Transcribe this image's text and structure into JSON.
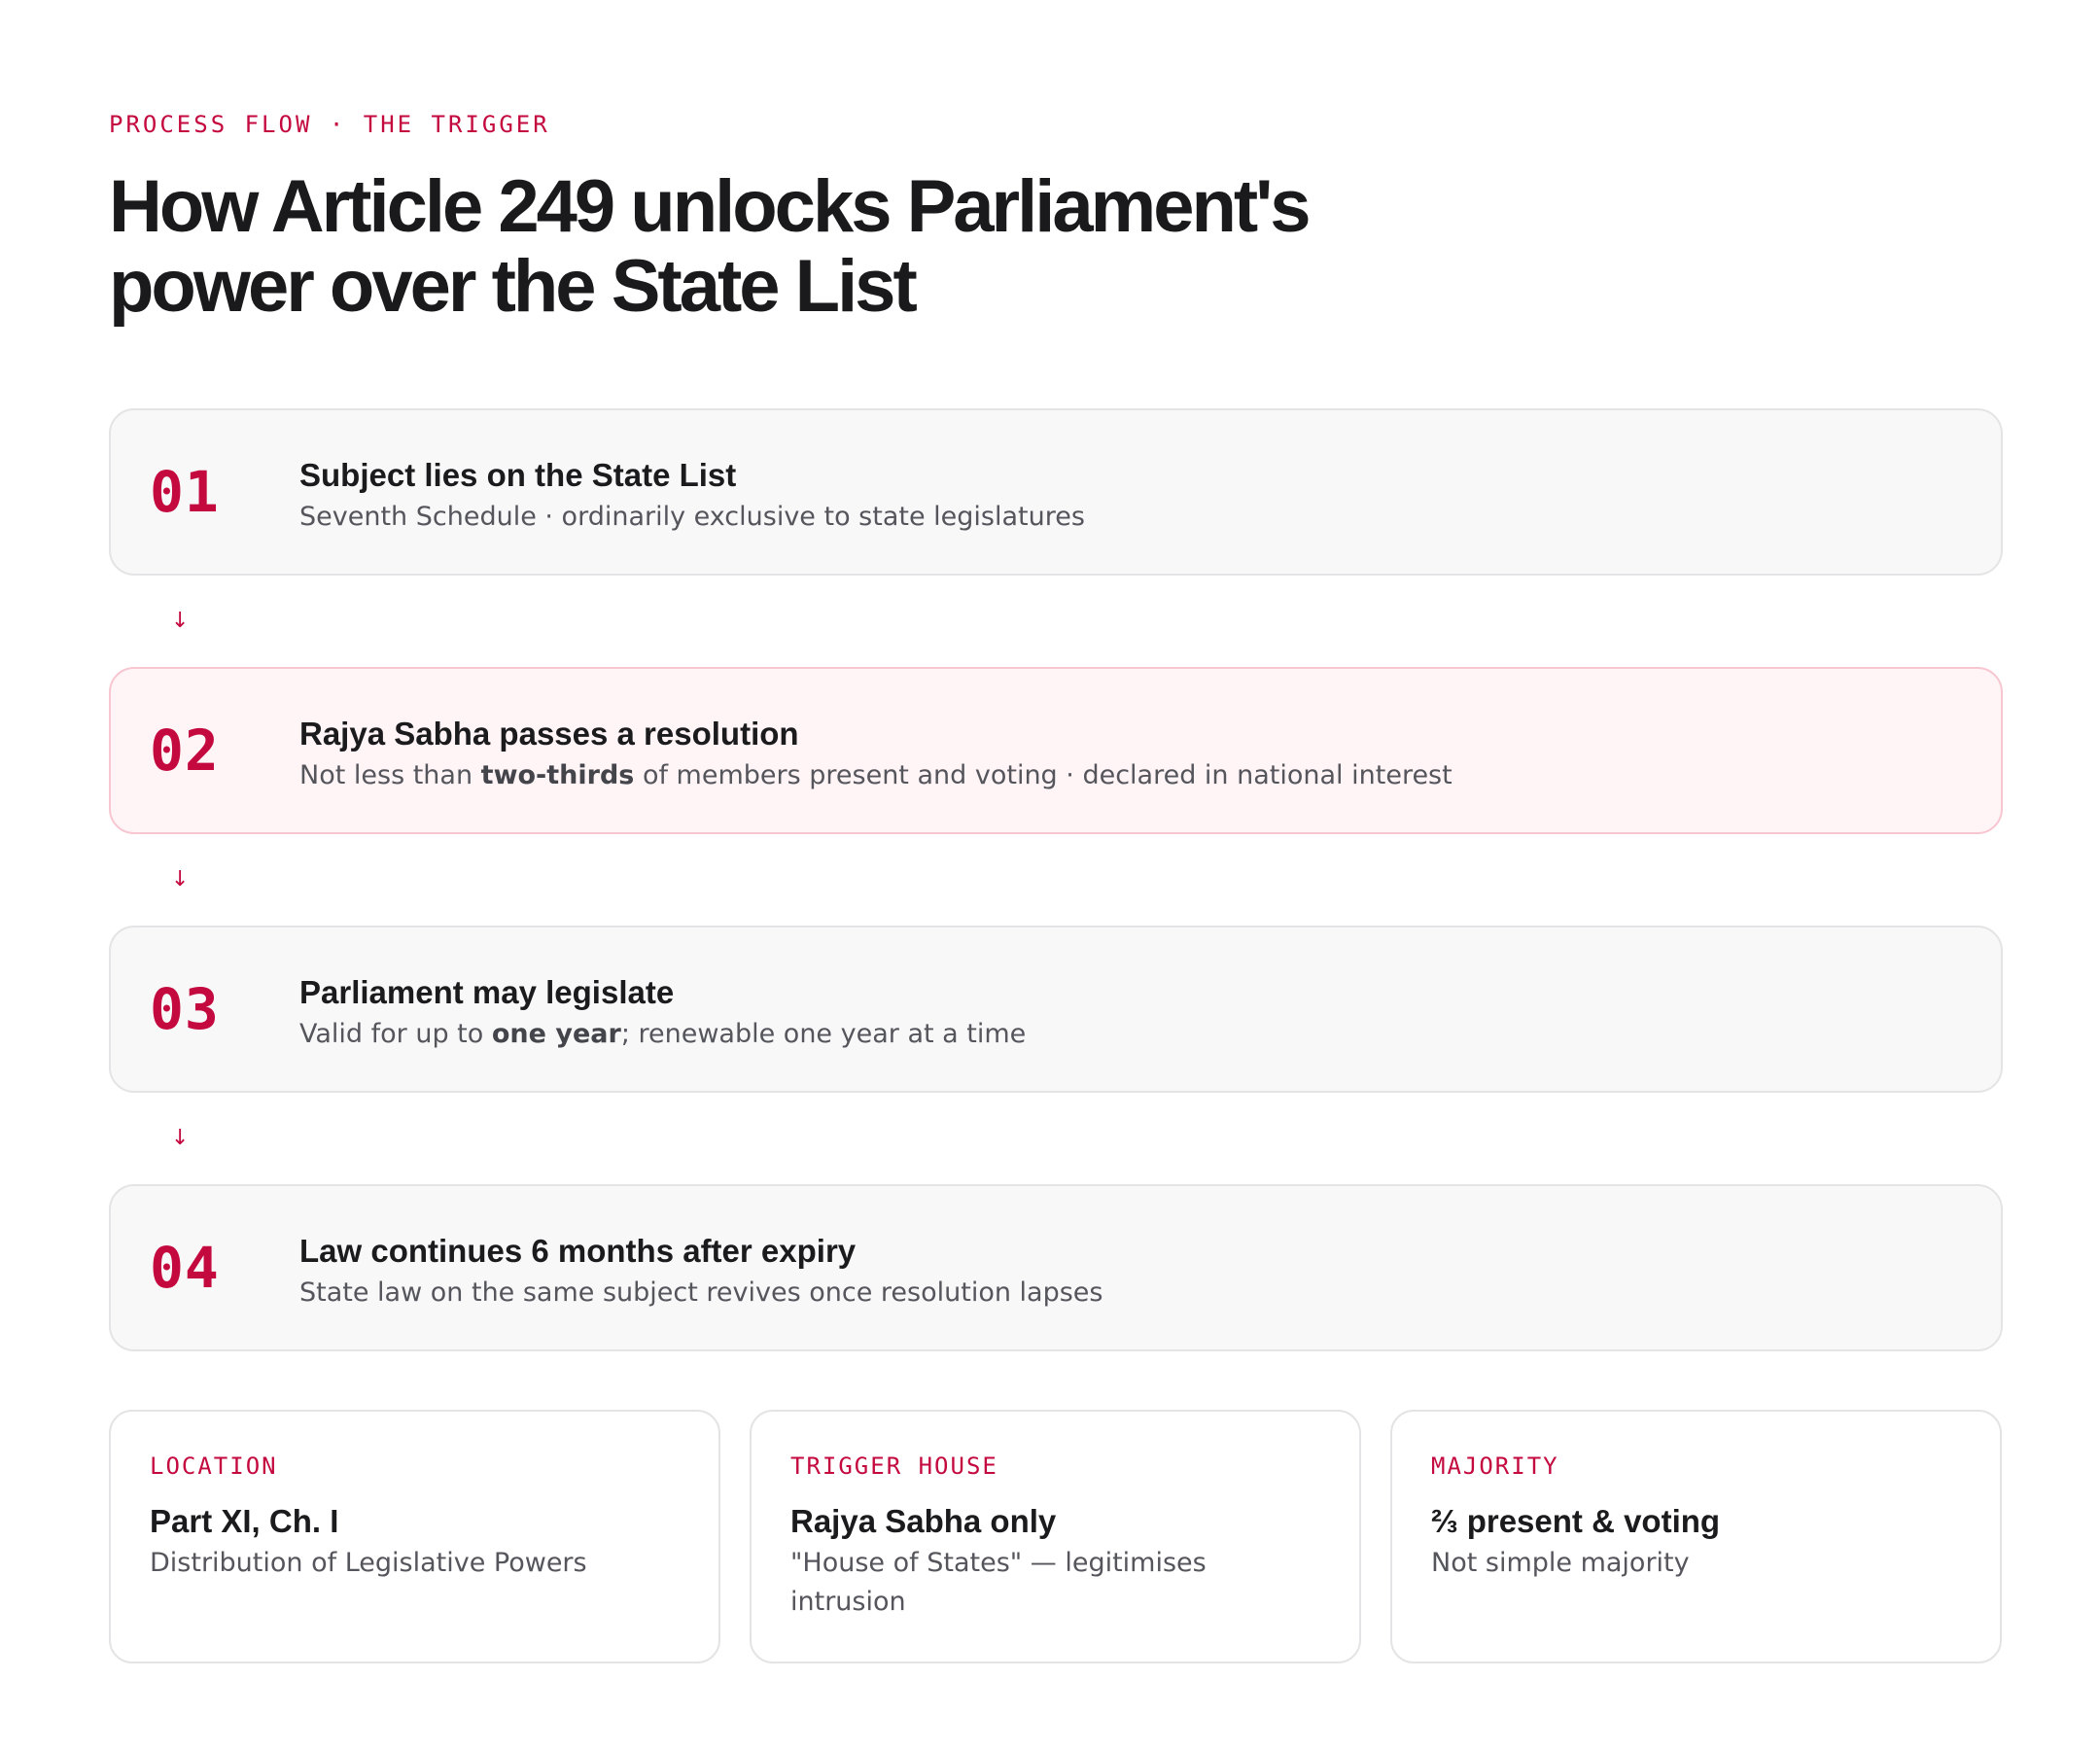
{
  "header": {
    "eyebrow": "PROCESS FLOW · THE TRIGGER",
    "title": "How Article 249 unlocks Parliament's power over the State List"
  },
  "steps": [
    {
      "number": "01",
      "title": "Subject lies on the State List",
      "subtitle_parts": [
        "Seventh Schedule · ordinarily exclusive to state legislatures"
      ],
      "highlight": false
    },
    {
      "number": "02",
      "title": "Rajya Sabha passes a resolution",
      "subtitle_parts": [
        "Not less than ",
        "two-thirds",
        " of members present and voting · declared in national interest"
      ],
      "highlight": true
    },
    {
      "number": "03",
      "title": "Parliament may legislate",
      "subtitle_parts": [
        "Valid for up to ",
        "one year",
        "; renewable one year at a time"
      ],
      "highlight": false
    },
    {
      "number": "04",
      "title": "Law continues 6 months after expiry",
      "subtitle_parts": [
        "State law on the same subject revives once resolution lapses"
      ],
      "highlight": false
    }
  ],
  "connector_icon": "arrow-down-icon",
  "connector_glyph": "↓",
  "cards": [
    {
      "label": "LOCATION",
      "value": "Part XI, Ch. I",
      "sub": "Distribution of Legislative Powers"
    },
    {
      "label": "TRIGGER HOUSE",
      "value": "Rajya Sabha only",
      "sub": "\"House of States\" — legitimises intrusion"
    },
    {
      "label": "MAJORITY",
      "value": "⅔ present & voting",
      "sub": "Not simple majority"
    }
  ],
  "colors": {
    "accent": "#c4093f",
    "card_bg": "#f8f8f9",
    "highlight_bg": "#fff4f6",
    "highlight_border": "#f7c6d0",
    "border": "#e4e4e6"
  }
}
